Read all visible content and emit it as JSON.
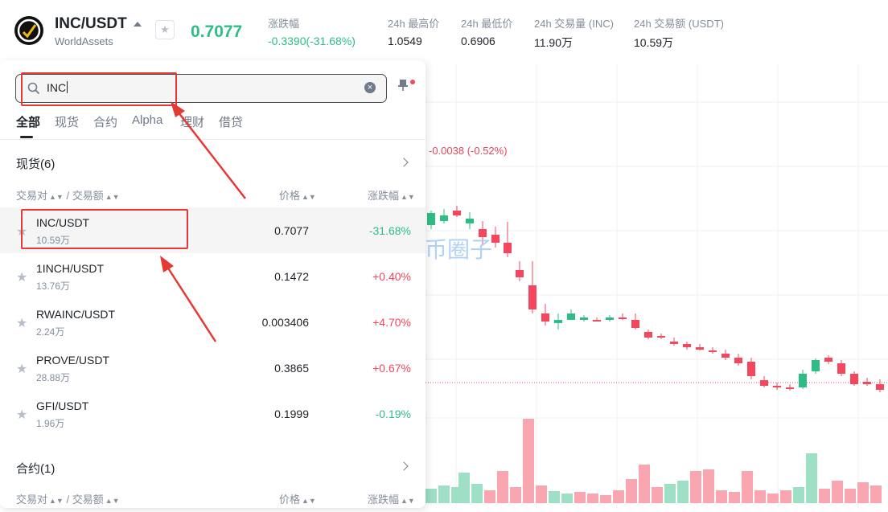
{
  "header": {
    "pair": "INC/USDT",
    "subtitle": "WorldAssets",
    "last_price": "0.7077",
    "stats": [
      {
        "label": "涨跌幅",
        "value": "-0.3390(-31.68%)",
        "negative": true
      },
      {
        "label": "24h 最高价",
        "value": "1.0549",
        "negative": false
      },
      {
        "label": "24h 最低价",
        "value": "0.6906",
        "negative": false
      },
      {
        "label": "24h 交易量 (INC)",
        "value": "11.90万",
        "negative": false
      },
      {
        "label": "24h 交易额 (USDT)",
        "value": "10.59万",
        "negative": false
      }
    ]
  },
  "chart": {
    "ohlc_change": "-0.0038 (-0.52%)",
    "watermark": "币圈子",
    "colors": {
      "up": "#2ebd85",
      "down": "#f6465d",
      "up_vol": "#9fdfc5",
      "down_vol": "#f8a7b0"
    }
  },
  "search": {
    "value": "INC"
  },
  "tabs": [
    "全部",
    "现货",
    "合约",
    "Alpha",
    "理财",
    "借贷"
  ],
  "spot_section": {
    "title": "现货(6)",
    "headers": {
      "pair": "交易对",
      "sep": "/",
      "turnover": "交易额",
      "price": "价格",
      "change": "涨跌幅"
    },
    "rows": [
      {
        "symbol": "INC/USDT",
        "volume": "10.59万",
        "price": "0.7077",
        "change": "-31.68%",
        "up": false,
        "highlight": true
      },
      {
        "symbol": "1INCH/USDT",
        "volume": "13.76万",
        "price": "0.1472",
        "change": "+0.40%",
        "up": true,
        "highlight": false
      },
      {
        "symbol": "RWAINC/USDT",
        "volume": "2.24万",
        "price": "0.003406",
        "change": "+4.70%",
        "up": true,
        "highlight": false
      },
      {
        "symbol": "PROVE/USDT",
        "volume": "28.88万",
        "price": "0.3865",
        "change": "+0.67%",
        "up": true,
        "highlight": false
      },
      {
        "symbol": "GFI/USDT",
        "volume": "1.96万",
        "price": "0.1999",
        "change": "-0.19%",
        "up": false,
        "highlight": false
      }
    ]
  },
  "futures_section": {
    "title": "合约(1)",
    "headers": {
      "pair": "交易对",
      "sep": "/",
      "turnover": "交易额",
      "price": "价格",
      "change": "涨跌幅"
    }
  }
}
